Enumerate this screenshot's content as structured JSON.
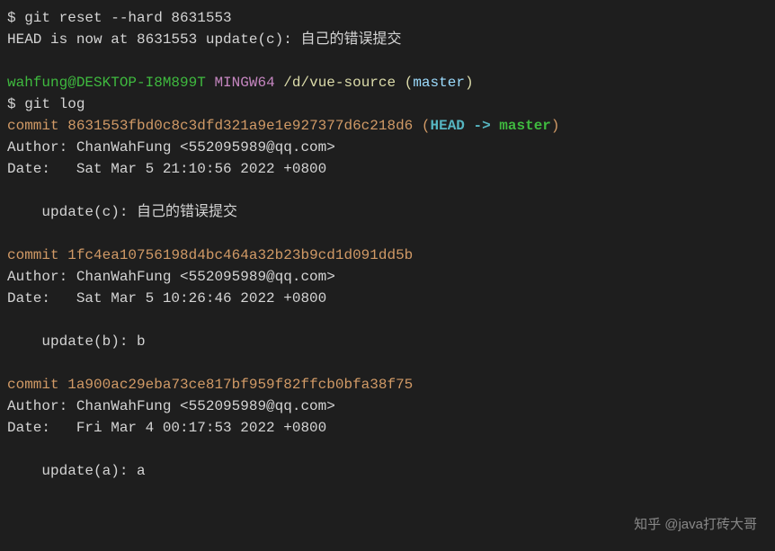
{
  "reset": {
    "prompt": "$ ",
    "cmd": "git reset --hard 8631553",
    "output": "HEAD is now at 8631553 update(c): 自己的错误提交"
  },
  "prompt2": {
    "user": "wahfung@DESKTOP-I8M899T",
    "mingw": "MINGW64",
    "path": "/d/vue-source",
    "branch_open": "(",
    "branch": "master",
    "branch_close": ")",
    "dollar": "$ ",
    "cmd": "git log"
  },
  "commits": [
    {
      "prefix": "commit ",
      "hash": "8631553fbd0c8c3dfd321a9e1e927377d6c218d6",
      "ref_open": " (",
      "head": "HEAD -> ",
      "master": "master",
      "ref_close": ")",
      "author": "Author: ChanWahFung <552095989@qq.com>",
      "date": "Date:   Sat Mar 5 21:10:56 2022 +0800",
      "msg": "    update(c): 自己的错误提交"
    },
    {
      "prefix": "commit ",
      "hash": "1fc4ea10756198d4bc464a32b23b9cd1d091dd5b",
      "author": "Author: ChanWahFung <552095989@qq.com>",
      "date": "Date:   Sat Mar 5 10:26:46 2022 +0800",
      "msg": "    update(b): b"
    },
    {
      "prefix": "commit ",
      "hash": "1a900ac29eba73ce817bf959f82ffcb0bfa38f75",
      "author": "Author: ChanWahFung <552095989@qq.com>",
      "date": "Date:   Fri Mar 4 00:17:53 2022 +0800",
      "msg": "    update(a): a"
    }
  ],
  "watermark": "知乎 @java打砖大哥"
}
